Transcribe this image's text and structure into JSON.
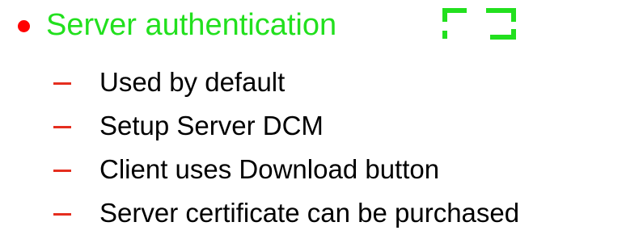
{
  "colors": {
    "heading": "#22e01e",
    "bullet": "#ff0000",
    "dash": "#e52e1f",
    "icon": "#22e01e",
    "text": "#000000"
  },
  "main_bullet": {
    "text": "Server authentication",
    "bullet_icon": "red-dot-icon",
    "trailing_icon": "corner-brackets-icon"
  },
  "sub_items": [
    {
      "dash_icon": "dash-icon",
      "text": "Used by default"
    },
    {
      "dash_icon": "dash-icon",
      "text": "Setup Server DCM"
    },
    {
      "dash_icon": "dash-icon",
      "text": "Client uses Download button"
    },
    {
      "dash_icon": "dash-icon",
      "text": "Server certificate can be purchased"
    }
  ]
}
